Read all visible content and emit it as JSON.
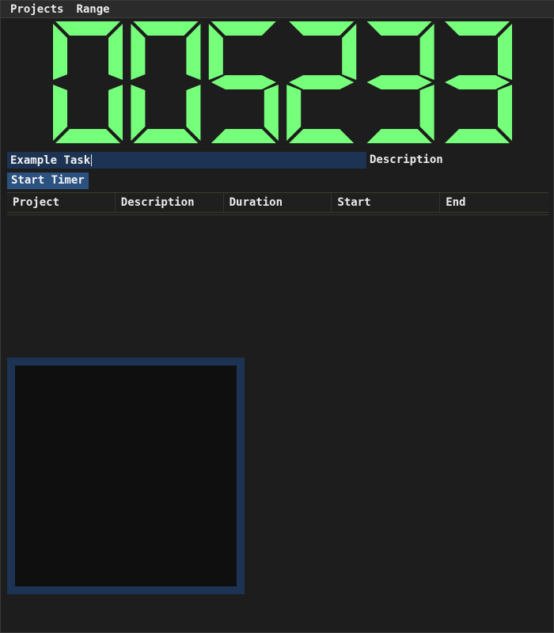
{
  "menu": {
    "items": [
      {
        "label": "Projects"
      },
      {
        "label": "Range"
      }
    ]
  },
  "clock": {
    "digits": [
      "0",
      "0",
      "5",
      "2",
      "3",
      "3"
    ],
    "display_text": "005233",
    "color": "#76ff7a"
  },
  "task": {
    "description_value": "Example Task",
    "description_label": "Description",
    "start_button_label": "Start Timer"
  },
  "table": {
    "columns": [
      "Project",
      "Description",
      "Duration",
      "Start",
      "End"
    ],
    "rows": []
  },
  "colors": {
    "accent": "#2a5180",
    "input_bg": "#1c3353",
    "background": "#1d1d1d",
    "digit": "#76ff7a"
  }
}
